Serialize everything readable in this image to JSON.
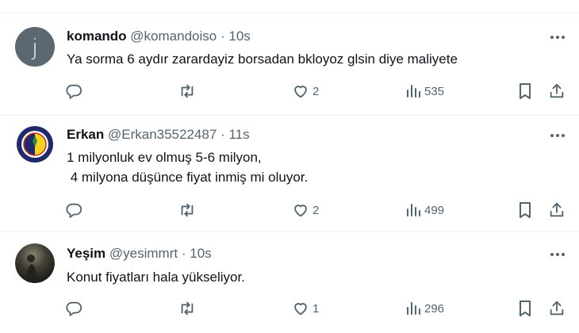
{
  "tweets": [
    {
      "avatar_letter": "j",
      "name": "komando",
      "handle": "@komandoiso",
      "separator": "·",
      "time": "10s",
      "text": "Ya sorma 6 aydır zarardayiz borsadan bkloyoz glsin diye maliyete",
      "likes": "2",
      "views": "535"
    },
    {
      "name": "Erkan",
      "handle": "@Erkan35522487",
      "separator": "·",
      "time": "11s",
      "text": "1 milyonluk ev olmuş 5-6 milyon,\n 4 milyona düşünce fiyat inmiş mi oluyor.",
      "likes": "2",
      "views": "499"
    },
    {
      "name": "Yeşim",
      "handle": "@yesimmrt",
      "separator": "·",
      "time": "10s",
      "text": "Konut fiyatları hala yükseliyor.",
      "likes": "1",
      "views": "296"
    }
  ],
  "colors": {
    "text": "#0f1419",
    "muted": "#536471",
    "divider": "#eff3f4",
    "avatar_gray": "#5b6771"
  },
  "icons": [
    "more-icon",
    "reply-icon",
    "retweet-icon",
    "like-icon",
    "views-icon",
    "bookmark-icon",
    "share-icon"
  ]
}
